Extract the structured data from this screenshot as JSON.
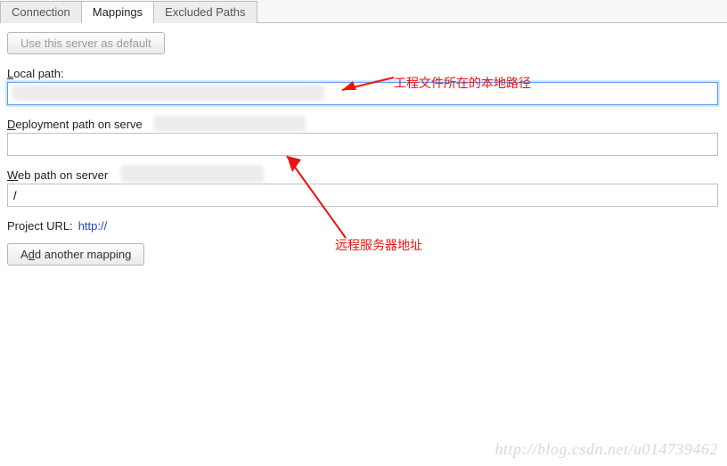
{
  "tabs": {
    "connection": "Connection",
    "mappings": "Mappings",
    "excluded": "Excluded Paths"
  },
  "buttons": {
    "use_default": "Use this server as default",
    "add_mapping_pre": "A",
    "add_mapping_u": "d",
    "add_mapping_post": "d another mapping"
  },
  "labels": {
    "local_path_u": "L",
    "local_path_rest": "ocal path:",
    "deploy_u": "D",
    "deploy_rest": "eployment path on serve",
    "web_u": "W",
    "web_rest": "eb path on server",
    "project_url": "Project URL:"
  },
  "values": {
    "local_path": "",
    "deploy_path": "",
    "web_path": "/",
    "project_url": "http://"
  },
  "annotations": {
    "a1": "工程文件所在的本地路径",
    "a2": "远程服务器地址"
  },
  "watermark": "http://blog.csdn.net/u014739462"
}
